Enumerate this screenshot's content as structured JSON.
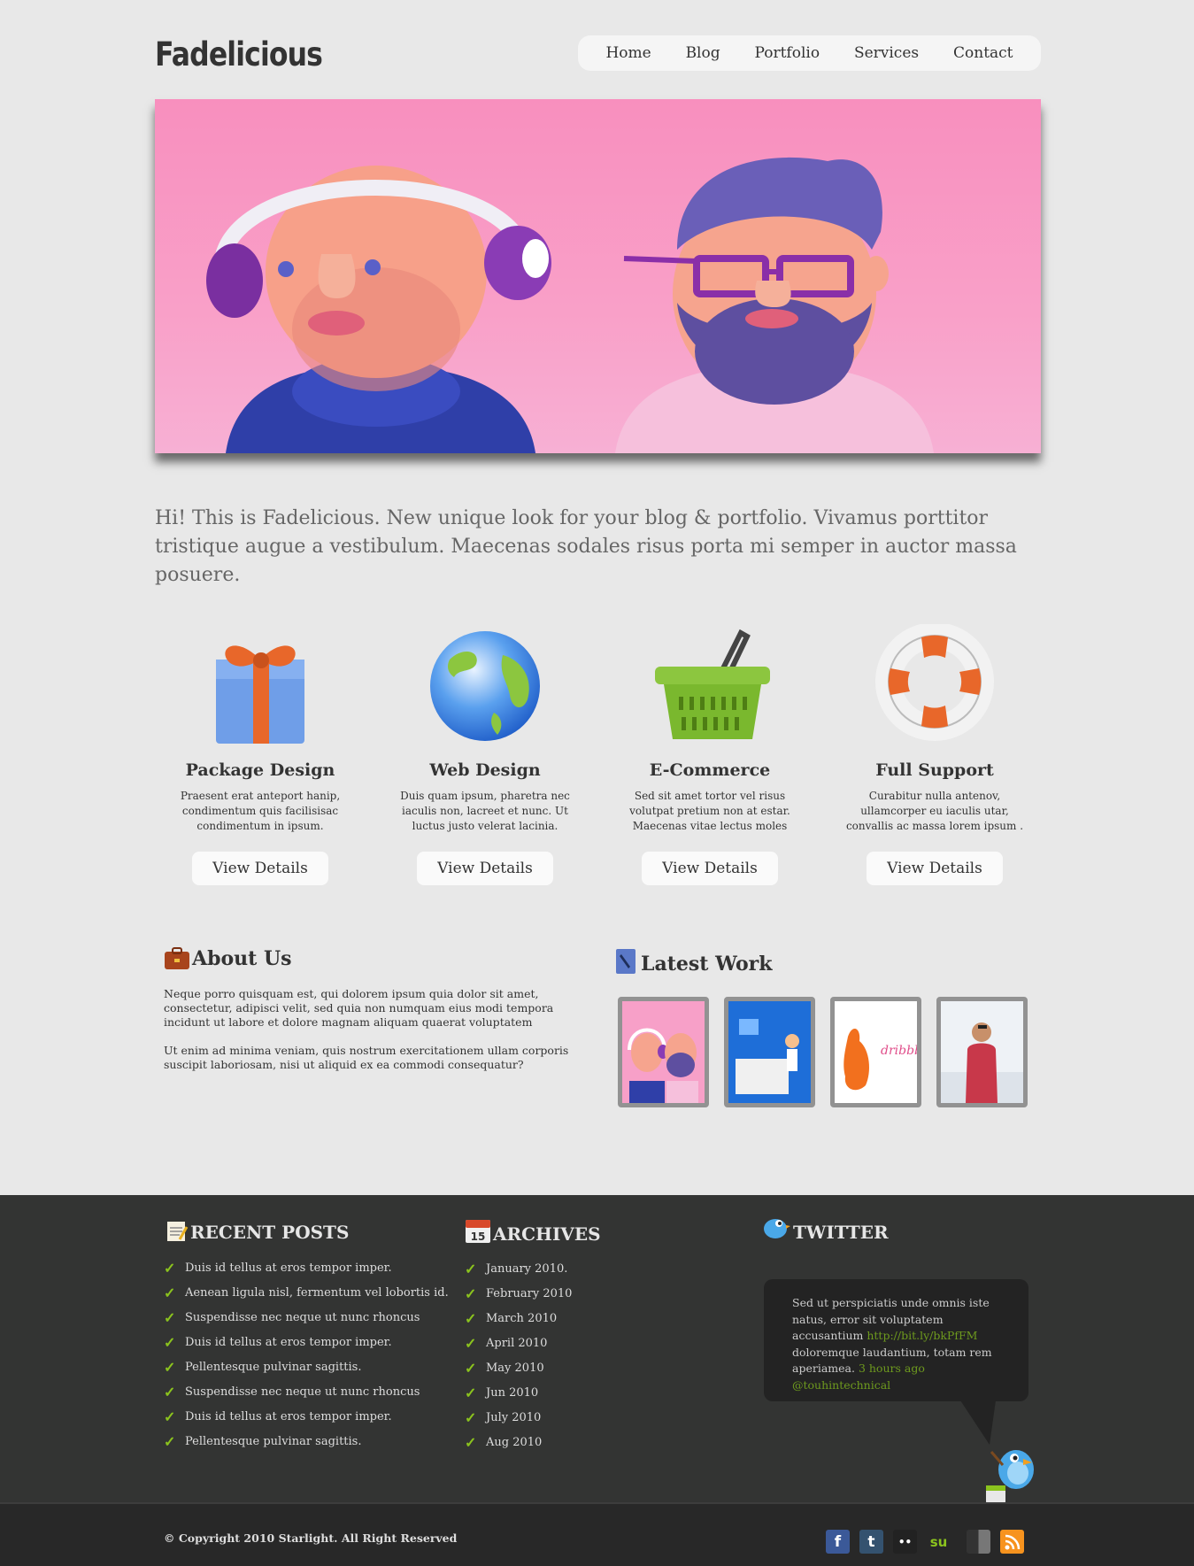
{
  "header": {
    "logo": "Fadelicious",
    "nav": [
      "Home",
      "Blog",
      "Portfolio",
      "Services",
      "Contact"
    ]
  },
  "intro": "Hi! This is Fadelicious. New unique look for your blog & portfolio. Vivamus porttitor tristique augue a vestibulum. Maecenas sodales risus porta mi semper in auctor massa posuere.",
  "features": [
    {
      "icon": "gift-icon",
      "title": "Package Design",
      "text": "Praesent erat anteport hanip, condimentum quis facilisisac condimentum in ipsum.",
      "button": "View Details"
    },
    {
      "icon": "globe-icon",
      "title": "Web Design",
      "text": "Duis quam ipsum, pharetra nec iaculis non, lacreet et nunc. Ut luctus justo velerat lacinia.",
      "button": "View Details"
    },
    {
      "icon": "basket-icon",
      "title": "E-Commerce",
      "text": "Sed sit amet tortor vel risus volutpat pretium non at estar. Maecenas vitae lectus moles",
      "button": "View Details"
    },
    {
      "icon": "lifebuoy-icon",
      "title": "Full Support",
      "text": "Curabitur nulla antenov, ullamcorper eu iaculis utar, convallis ac massa lorem ipsum .",
      "button": "View Details"
    }
  ],
  "about": {
    "title": "About Us",
    "p1": "Neque porro quisquam est, qui dolorem ipsum quia dolor sit amet, consectetur, adipisci velit, sed quia non numquam eius modi tempora incidunt ut labore et dolore magnam aliquam quaerat voluptatem",
    "p2": "Ut enim ad minima veniam, quis nostrum exercitationem ullam corporis suscipit laboriosam, nisi ut aliquid ex ea commodi consequatur?"
  },
  "latest_work": {
    "title": "Latest Work"
  },
  "recent_posts": {
    "title": "RECENT POSTS",
    "items": [
      "Duis id tellus at eros tempor imper.",
      "Aenean ligula nisl, fermentum vel lobortis id.",
      "Suspendisse nec neque ut nunc rhoncus",
      "Duis id tellus at eros tempor imper.",
      "Pellentesque pulvinar sagittis.",
      "Suspendisse nec neque ut nunc rhoncus",
      "Duis id tellus at eros tempor imper.",
      "Pellentesque pulvinar sagittis."
    ]
  },
  "archives": {
    "title": "ARCHIVES",
    "calendar_day": "15",
    "items": [
      "January 2010.",
      "February 2010",
      "March 2010",
      "April 2010",
      "May 2010",
      "Jun 2010",
      "July 2010",
      "Aug 2010"
    ]
  },
  "twitter": {
    "title": "TWITTER",
    "text": "Sed ut perspiciatis unde omnis iste natus, error sit voluptatem accusantium",
    "link": "http://bit.ly/bkPfFM",
    "text2": "doloremque laudantium, totam rem aperiamea.",
    "time": "3 hours ago",
    "handle": "@touhintechnical"
  },
  "footer": {
    "copyright": "© Copyright 2010 Starlight. All Right Reserved",
    "social": [
      {
        "icon": "facebook-icon",
        "glyph": "f",
        "color": "#3b5998"
      },
      {
        "icon": "tumblr-icon",
        "glyph": "t",
        "color": "#34526f"
      },
      {
        "icon": "flickr-icon",
        "glyph": "••",
        "color": "#222222"
      },
      {
        "icon": "stumbleupon-icon",
        "glyph": "su",
        "color": "#8bc31e"
      },
      {
        "icon": "delicious-icon",
        "glyph": "",
        "color": "#555555"
      },
      {
        "icon": "rss-icon",
        "glyph": "",
        "color": "#f7931e"
      }
    ]
  },
  "colors": {
    "accent_green": "#8bc31e",
    "banner_pink": "#f88fbe",
    "footer_bg": "#333433"
  }
}
